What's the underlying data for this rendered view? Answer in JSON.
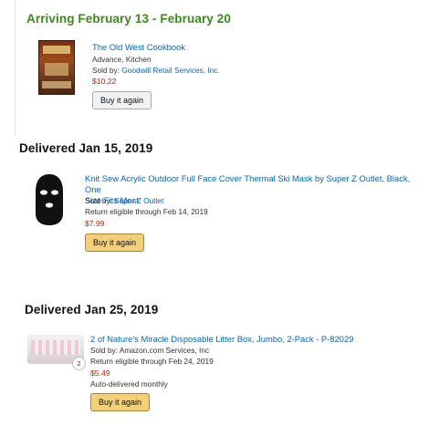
{
  "order1": {
    "heading": "Arriving February 13 - February 20",
    "item": {
      "title": "The Old West Cookbook",
      "subtitle": "Advance, Kitchen",
      "sold_by_label": "Sold by: ",
      "seller": "Goodwill Retail Services, Inc.",
      "price": "$10.22",
      "button": "Buy it again"
    }
  },
  "order2": {
    "heading": "Delivered Jan 15, 2019",
    "item": {
      "title_line1": "Knit Sew Acrylic Outdoor Full Face Cover Thermal Ski Mask by Super Z Outlet, Black, One",
      "title_line2": "Size Fits Most",
      "sold_by_label": "Sold by: ",
      "seller": "Super Z Outlet",
      "return_info": "Return eligible through Feb 14, 2019",
      "price": "$7.99",
      "button": "Buy it again"
    }
  },
  "order3": {
    "heading": "Delivered Jan 25, 2019",
    "item": {
      "title": "2 of Nature's Miracle Disposable Litter Box, Jumbo, 2-Pack - P-82029",
      "sold_by": "Sold by: Amazon.com Services, Inc",
      "return_info": "Return eligible through Feb 24, 2019",
      "price": "$5.49",
      "delivery_note": "Auto-delivered monthly",
      "quantity": "2",
      "button": "Buy it again"
    }
  },
  "colors": {
    "arriving_green": "#3a8a1c",
    "link_blue": "#0b66b8",
    "price_red": "#b12704",
    "buy_again_yellow": "#f3d077"
  }
}
